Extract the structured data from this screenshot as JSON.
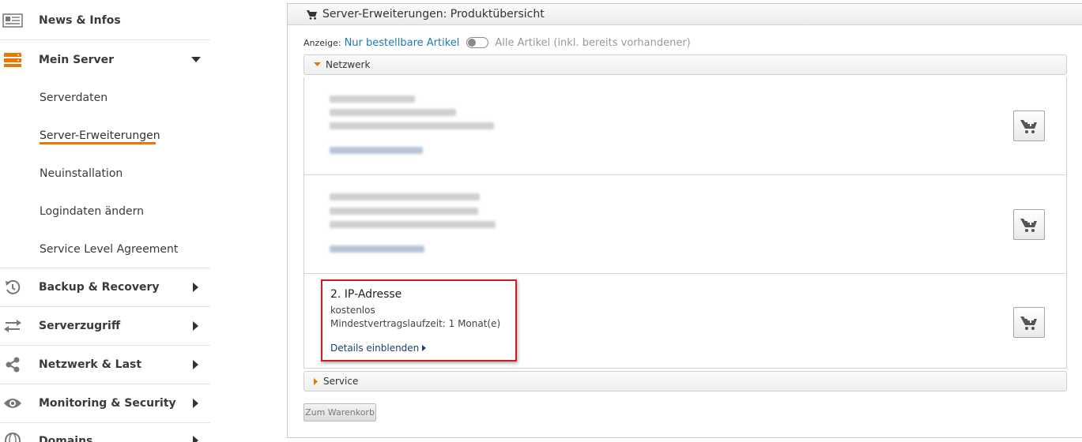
{
  "sidebar": {
    "items": [
      {
        "label": "News & Infos",
        "icon": "newspaper-icon"
      },
      {
        "label": "Mein Server",
        "icon": "server-icon"
      },
      {
        "label": "Backup & Recovery",
        "icon": "history-icon"
      },
      {
        "label": "Serverzugriff",
        "icon": "transfer-arrows-icon"
      },
      {
        "label": "Netzwerk & Last",
        "icon": "share-nodes-icon"
      },
      {
        "label": "Monitoring & Security",
        "icon": "eye-icon"
      },
      {
        "label": "Domains",
        "icon": "globe-icon"
      }
    ],
    "subitems": [
      {
        "label": "Serverdaten"
      },
      {
        "label": "Server-Erweiterungen",
        "active": true
      },
      {
        "label": "Neuinstallation"
      },
      {
        "label": "Logindaten ändern"
      },
      {
        "label": "Service Level Agreement"
      }
    ],
    "accent_color": "#ea7800"
  },
  "panel": {
    "title": "Server-Erweiterungen: Produktübersicht",
    "filter": {
      "label": "Anzeige:",
      "option_orderable": "Nur bestellbare Artikel",
      "option_all": "Alle Artikel (inkl. bereits vorhandener)"
    },
    "sections": [
      {
        "title": "Netzwerk",
        "expanded": true
      },
      {
        "title": "Service",
        "expanded": false
      }
    ],
    "product": {
      "title": "2. IP-Adresse",
      "price": "kostenlos",
      "term": "Mindestvertragslaufzeit: 1 Monat(e)",
      "details": "Details einblenden"
    },
    "submit_label": "Zum Warenkorb"
  }
}
